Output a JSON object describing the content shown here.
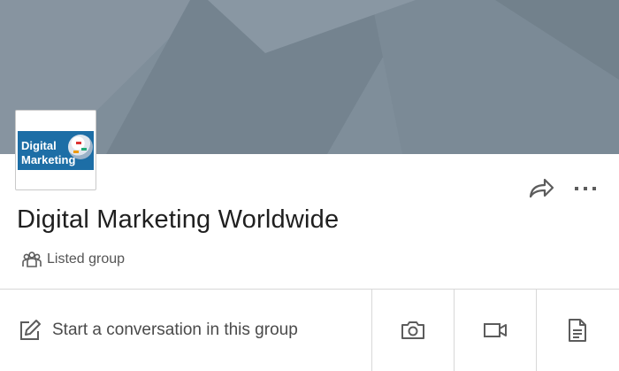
{
  "group": {
    "name": "Digital Marketing Worldwide",
    "visibility": "Listed group",
    "logo": {
      "line1": "Digital",
      "line2": "Marketing"
    }
  },
  "composer": {
    "start_label": "Start a conversation in this group"
  },
  "icons": {
    "share": "share-icon",
    "more": "more-icon",
    "visibility": "people-icon",
    "compose": "compose-icon",
    "photo": "camera-icon",
    "video": "video-icon",
    "document": "document-icon"
  },
  "colors": {
    "banner": "#7f8e9a",
    "logo_background": "#1d6ea6",
    "icon": "#5c5c5c",
    "divider": "#d8d8d8"
  }
}
